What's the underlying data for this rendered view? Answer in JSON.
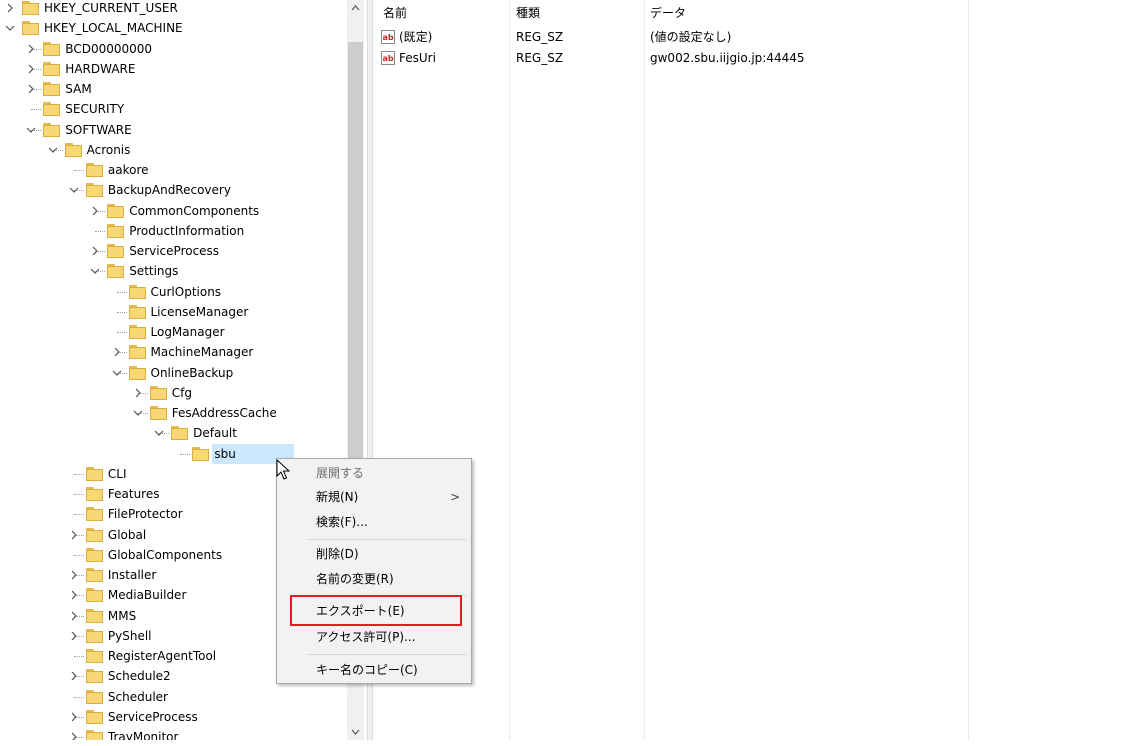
{
  "tree": {
    "nodes": [
      {
        "label": "HKEY_CURRENT_USER",
        "depth": 0,
        "exp": ">"
      },
      {
        "label": "HKEY_LOCAL_MACHINE",
        "depth": 0,
        "exp": "v"
      },
      {
        "label": "BCD00000000",
        "depth": 1,
        "exp": ">"
      },
      {
        "label": "HARDWARE",
        "depth": 1,
        "exp": ">"
      },
      {
        "label": "SAM",
        "depth": 1,
        "exp": ">"
      },
      {
        "label": "SECURITY",
        "depth": 1,
        "exp": ""
      },
      {
        "label": "SOFTWARE",
        "depth": 1,
        "exp": "v"
      },
      {
        "label": "Acronis",
        "depth": 2,
        "exp": "v"
      },
      {
        "label": "aakore",
        "depth": 3,
        "exp": ""
      },
      {
        "label": "BackupAndRecovery",
        "depth": 3,
        "exp": "v"
      },
      {
        "label": "CommonComponents",
        "depth": 4,
        "exp": ">"
      },
      {
        "label": "ProductInformation",
        "depth": 4,
        "exp": ""
      },
      {
        "label": "ServiceProcess",
        "depth": 4,
        "exp": ">"
      },
      {
        "label": "Settings",
        "depth": 4,
        "exp": "v"
      },
      {
        "label": "CurlOptions",
        "depth": 5,
        "exp": ""
      },
      {
        "label": "LicenseManager",
        "depth": 5,
        "exp": ""
      },
      {
        "label": "LogManager",
        "depth": 5,
        "exp": ""
      },
      {
        "label": "MachineManager",
        "depth": 5,
        "exp": ">"
      },
      {
        "label": "OnlineBackup",
        "depth": 5,
        "exp": "v"
      },
      {
        "label": "Cfg",
        "depth": 6,
        "exp": ">"
      },
      {
        "label": "FesAddressCache",
        "depth": 6,
        "exp": "v"
      },
      {
        "label": "Default",
        "depth": 7,
        "exp": "v"
      },
      {
        "label": "sbu",
        "depth": 8,
        "exp": "",
        "selected": true
      },
      {
        "label": "CLI",
        "depth": 3,
        "exp": ""
      },
      {
        "label": "Features",
        "depth": 3,
        "exp": ""
      },
      {
        "label": "FileProtector",
        "depth": 3,
        "exp": ""
      },
      {
        "label": "Global",
        "depth": 3,
        "exp": ">"
      },
      {
        "label": "GlobalComponents",
        "depth": 3,
        "exp": ""
      },
      {
        "label": "Installer",
        "depth": 3,
        "exp": ">"
      },
      {
        "label": "MediaBuilder",
        "depth": 3,
        "exp": ">"
      },
      {
        "label": "MMS",
        "depth": 3,
        "exp": ">"
      },
      {
        "label": "PyShell",
        "depth": 3,
        "exp": ">"
      },
      {
        "label": "RegisterAgentTool",
        "depth": 3,
        "exp": ""
      },
      {
        "label": "Schedule2",
        "depth": 3,
        "exp": ">"
      },
      {
        "label": "Scheduler",
        "depth": 3,
        "exp": ""
      },
      {
        "label": "ServiceProcess",
        "depth": 3,
        "exp": ">"
      },
      {
        "label": "TrayMonitor",
        "depth": 3,
        "exp": ">"
      }
    ]
  },
  "list": {
    "headers": {
      "name": "名前",
      "type": "種類",
      "data": "データ"
    },
    "rows": [
      {
        "icon": "ab",
        "name": "(既定)",
        "type": "REG_SZ",
        "data": "(値の設定なし)"
      },
      {
        "icon": "ab",
        "name": "FesUri",
        "type": "REG_SZ",
        "data": "gw002.sbu.iijgio.jp:44445"
      }
    ]
  },
  "menu": {
    "expand": "展開する",
    "new": "新規(N)",
    "new_arrow": ">",
    "find": "検索(F)...",
    "delete": "削除(D)",
    "rename": "名前の変更(R)",
    "export": "エクスポート(E)",
    "permissions": "アクセス許可(P)...",
    "copy_key": "キー名のコピー(C)"
  },
  "scroll": {
    "up": "^",
    "down": "v"
  },
  "colors": {
    "highlight": "#e02020",
    "selection": "#cce8ff",
    "folder": "#f8d775"
  }
}
